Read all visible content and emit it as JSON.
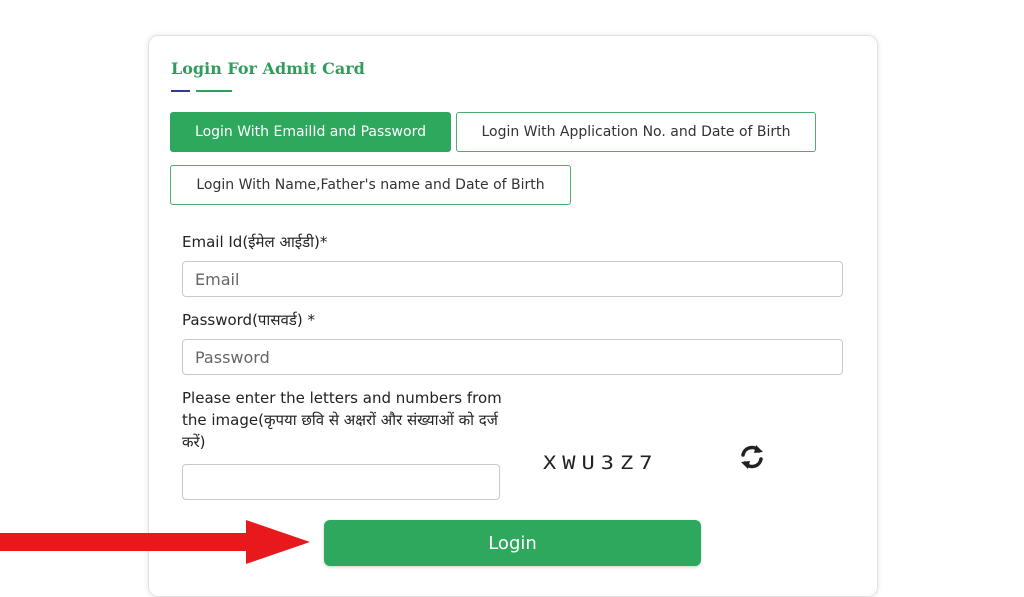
{
  "form": {
    "title": "Login For Admit Card",
    "tabs": [
      {
        "label": "Login With EmailId and Password",
        "active": true
      },
      {
        "label": "Login With Application No. and Date of Birth",
        "active": false
      },
      {
        "label": "Login With Name,Father's name and Date of Birth",
        "active": false
      }
    ],
    "email": {
      "label": "Email Id(ईमेल आईडी)*",
      "placeholder": "Email",
      "value": ""
    },
    "password": {
      "label": "Password(पासवर्ड) *",
      "placeholder": "Password",
      "value": ""
    },
    "captcha": {
      "label": "Please enter the letters and numbers from the image(कृपया छवि से अक्षरों और संख्याओं को दर्ज करें)",
      "value": "",
      "image_text": "XWU3Z7",
      "refresh_icon": "refresh-icon"
    },
    "login_label": "Login"
  },
  "annotation": {
    "arrow_icon": "arrow-right-icon",
    "arrow_color": "#e8191c"
  },
  "colors": {
    "accent": "#2ea85c",
    "title": "#2f9e5a",
    "secondary": "#2c3e8f"
  }
}
